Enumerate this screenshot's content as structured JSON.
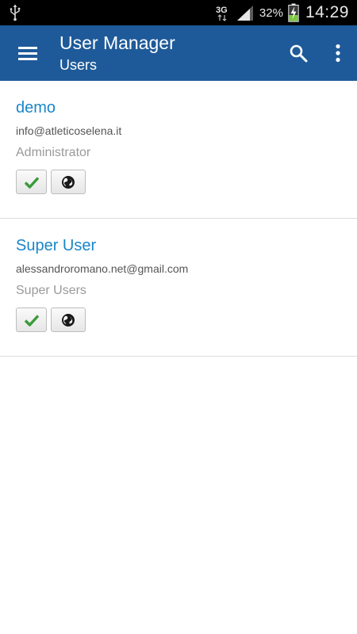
{
  "status_bar": {
    "network": "3G",
    "battery": "32%",
    "time": "14:29"
  },
  "toolbar": {
    "title": "User Manager",
    "subtitle": "Users",
    "menu_icon": "hamburger-menu-icon",
    "search_icon": "search-icon",
    "overflow_icon": "overflow-menu-icon",
    "color": "#1e5a99"
  },
  "users": [
    {
      "name": "demo",
      "email": "info@atleticoselena.it",
      "group": "Administrator",
      "actions": [
        "activated-check-icon",
        "globe-icon"
      ]
    },
    {
      "name": "Super User",
      "email": "alessandroromano.net@gmail.com",
      "group": "Super Users",
      "actions": [
        "activated-check-icon",
        "globe-icon"
      ]
    }
  ],
  "colors": {
    "link": "#1a86c8",
    "check": "#3a9a3a"
  }
}
